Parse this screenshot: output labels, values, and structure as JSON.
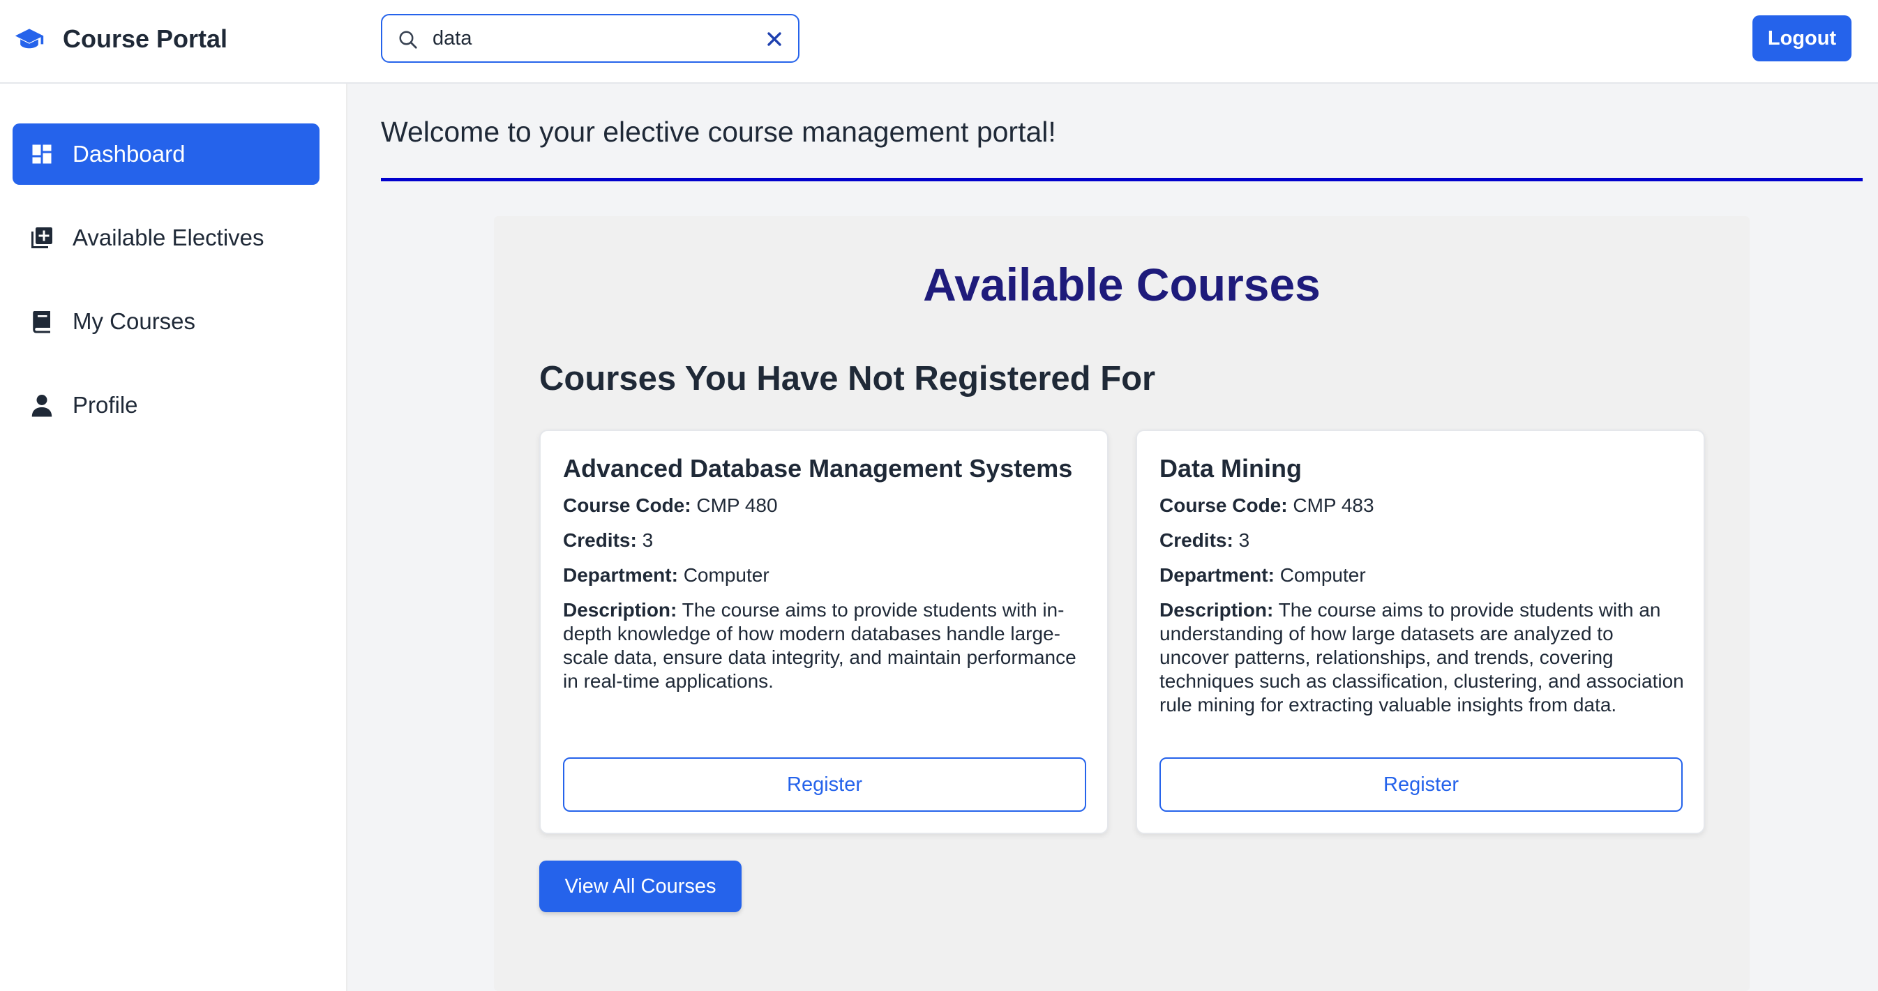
{
  "app": {
    "brand_name": "Course Portal",
    "brand_icon": "graduation-cap-icon",
    "accent_color": "#2563eb"
  },
  "search": {
    "value": "data",
    "placeholder": "",
    "icon": "search-icon",
    "clear_icon": "close-icon"
  },
  "header": {
    "logout_label": "Logout"
  },
  "sidebar": {
    "items": [
      {
        "label": "Dashboard",
        "icon": "dashboard-icon",
        "active": true
      },
      {
        "label": "Available Electives",
        "icon": "add-book-icon",
        "active": false
      },
      {
        "label": "My Courses",
        "icon": "book-icon",
        "active": false
      },
      {
        "label": "Profile",
        "icon": "user-icon",
        "active": false
      }
    ]
  },
  "main": {
    "welcome": "Welcome to your elective course management portal!",
    "panel_title": "Available Courses",
    "section_title": "Courses You Have Not Registered For",
    "field_labels": {
      "code": "Course Code:",
      "credits": "Credits:",
      "department": "Department:",
      "description": "Description:"
    },
    "courses": [
      {
        "title": "Advanced Database Management Systems",
        "code": "CMP 480",
        "credits": "3",
        "department": "Computer",
        "description": "The course aims to provide students with in-depth knowledge of how modern databases handle large-scale data, ensure data integrity, and maintain performance in real-time applications.",
        "register_label": "Register"
      },
      {
        "title": "Data Mining",
        "code": "CMP 483",
        "credits": "3",
        "department": "Computer",
        "description": "The course aims to provide students with an understanding of how large datasets are analyzed to uncover patterns, relationships, and trends, covering techniques such as classification, clustering, and association rule mining for extracting valuable insights from data.",
        "register_label": "Register"
      }
    ],
    "view_all_label": "View All Courses"
  }
}
